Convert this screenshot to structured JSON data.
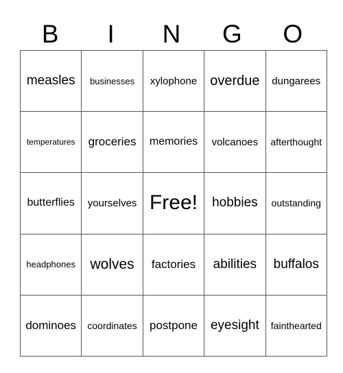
{
  "header": {
    "letters": [
      "B",
      "I",
      "N",
      "G",
      "O"
    ]
  },
  "board": {
    "rows": [
      [
        "measles",
        "businesses",
        "xylophone",
        "overdue",
        "dungarees"
      ],
      [
        "temperatures",
        "groceries",
        "memories",
        "volcanoes",
        "afterthought"
      ],
      [
        "butterflies",
        "yourselves",
        "Free!",
        "hobbies",
        "outstanding"
      ],
      [
        "headphones",
        "wolves",
        "factories",
        "abilities",
        "buffalos"
      ],
      [
        "dominoes",
        "coordinates",
        "postpone",
        "eyesight",
        "fainthearted"
      ]
    ]
  }
}
